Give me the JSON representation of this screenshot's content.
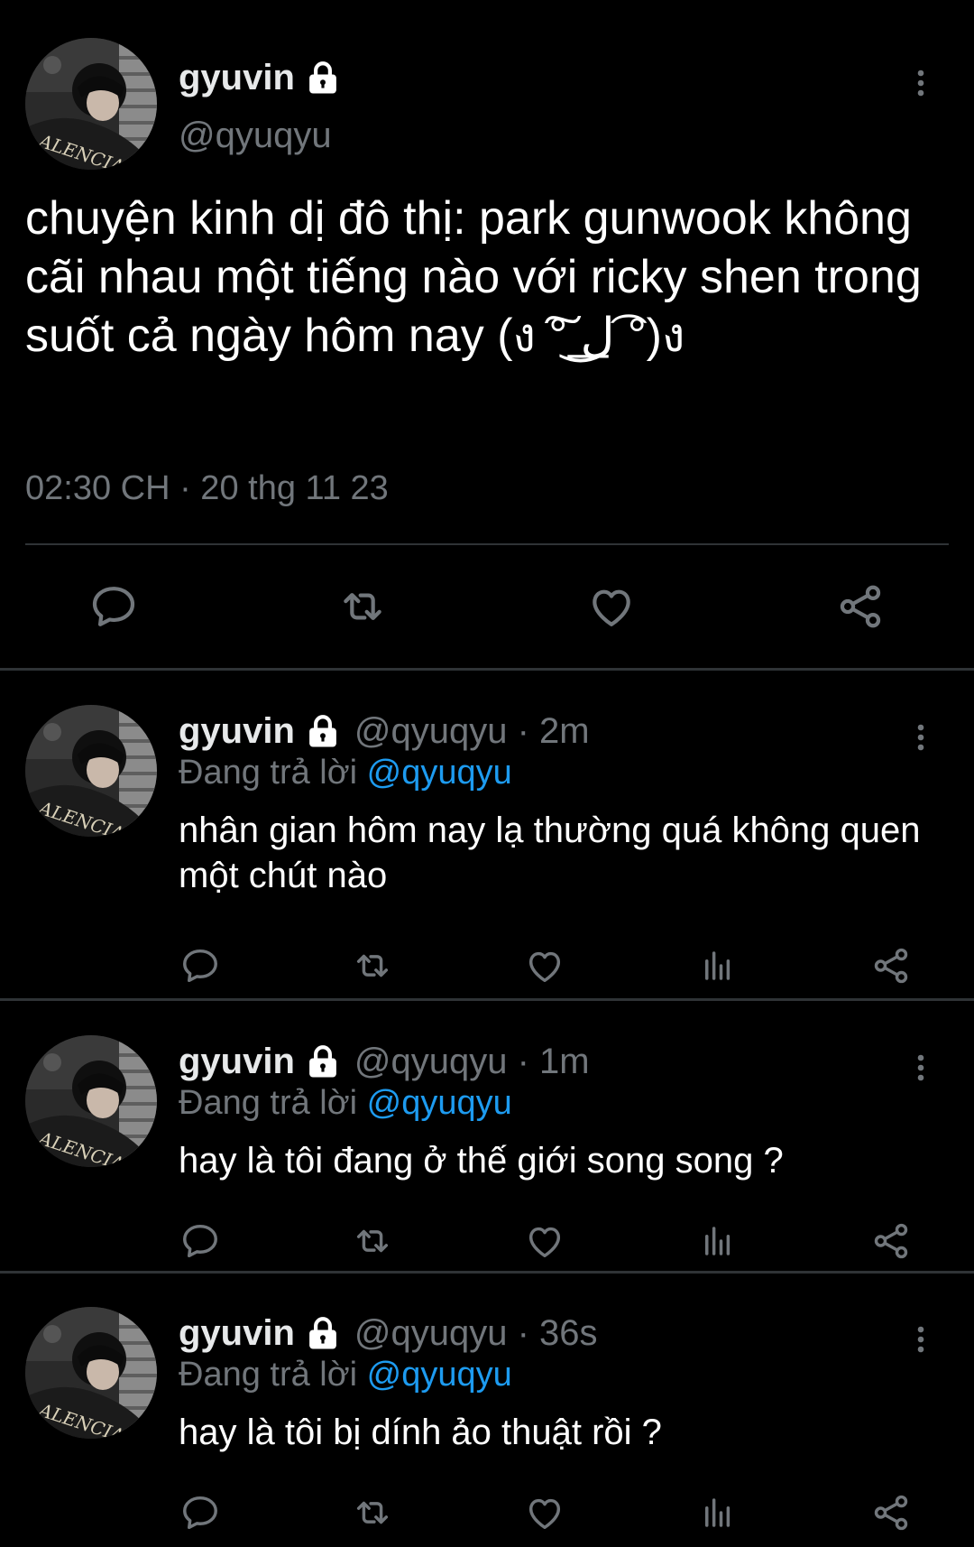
{
  "colors": {
    "background": "#000000",
    "text_primary": "#ffffff",
    "text_secondary": "#71767b",
    "divider": "#2f3336",
    "mention": "#1d9bf0"
  },
  "main_tweet": {
    "display_name": "gyuvin",
    "handle": "@qyuqyu",
    "text": "chuyện kinh dị đô thị: park gunwook không cãi nhau một tiếng nào với ricky shen trong suốt cả ngày hôm nay (ง ͠° ͟ل͜ ͡°)ง",
    "timestamp": "02:30 CH · 20 thg 11 23",
    "icons": {
      "avatar": "avatar",
      "lock": "lock-icon",
      "more": "more-vertical-icon",
      "reply": "reply-icon",
      "retweet": "retweet-icon",
      "like": "heart-icon",
      "share": "share-icon"
    }
  },
  "replies": [
    {
      "display_name": "gyuvin",
      "handle_time": "@qyuqyu · 2m",
      "replying_prefix": "Đang trả lời",
      "replying_to": "@qyuqyu",
      "text": "nhân gian hôm nay lạ thường quá không quen một chút nào"
    },
    {
      "display_name": "gyuvin",
      "handle_time": "@qyuqyu · 1m",
      "replying_prefix": "Đang trả lời",
      "replying_to": "@qyuqyu",
      "text": "hay là tôi đang ở thế giới song song ?"
    },
    {
      "display_name": "gyuvin",
      "handle_time": "@qyuqyu · 36s",
      "replying_prefix": "Đang trả lời",
      "replying_to": "@qyuqyu",
      "text": "hay là tôi bị dính ảo thuật rồi ?"
    }
  ]
}
